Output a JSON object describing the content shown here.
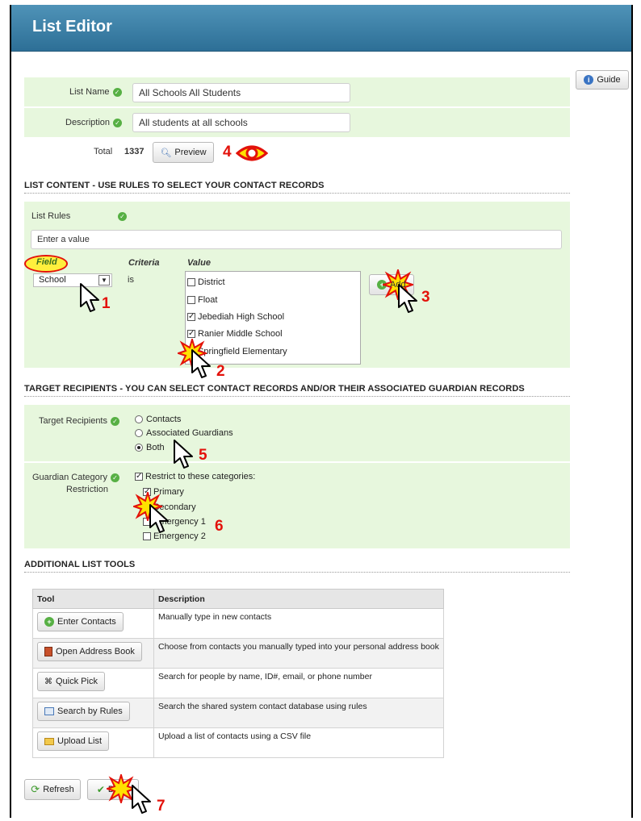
{
  "window": {
    "title": "List Editor"
  },
  "guide_button": {
    "label": "Guide",
    "icon": "info-icon"
  },
  "list_name": {
    "label": "List Name",
    "value": "All Schools All Students"
  },
  "description": {
    "label": "Description",
    "value": "All students at all schools"
  },
  "total": {
    "label": "Total",
    "value": "1337",
    "preview_label": "Preview"
  },
  "sections": {
    "list_content": "LIST CONTENT - USE RULES TO SELECT YOUR CONTACT RECORDS",
    "target_recipients": "TARGET RECIPIENTS - YOU CAN SELECT CONTACT RECORDS AND/OR THEIR ASSOCIATED GUARDIAN RECORDS",
    "additional_tools": "ADDITIONAL LIST TOOLS"
  },
  "list_rules": {
    "label": "List Rules",
    "input_value": "Enter a value",
    "field_header": "Field",
    "criteria_header": "Criteria",
    "value_header": "Value",
    "field_selected": "School",
    "criteria_value": "is",
    "values": [
      {
        "label": "District",
        "checked": false
      },
      {
        "label": "Float",
        "checked": false
      },
      {
        "label": "Jebediah High School",
        "checked": true
      },
      {
        "label": "Ranier Middle School",
        "checked": true
      },
      {
        "label": "Springfield Elementary",
        "checked": true
      }
    ],
    "add_label": "Add"
  },
  "target": {
    "label": "Target Recipients",
    "options": [
      {
        "label": "Contacts",
        "selected": false
      },
      {
        "label": "Associated Guardians",
        "selected": false
      },
      {
        "label": "Both",
        "selected": true
      }
    ]
  },
  "guardian": {
    "label_line1": "Guardian Category",
    "label_line2": "Restriction",
    "restrict_label": "Restrict to these categories:",
    "restrict_checked": true,
    "categories": [
      {
        "label": "Primary",
        "checked": true
      },
      {
        "label": "Secondary",
        "checked": true
      },
      {
        "label": "Emergency 1",
        "checked": false
      },
      {
        "label": "Emergency 2",
        "checked": false
      }
    ]
  },
  "tools_table": {
    "col_tool": "Tool",
    "col_description": "Description",
    "rows": [
      {
        "button": "Enter Contacts",
        "icon": "plus-icon",
        "description": "Manually type in new contacts"
      },
      {
        "button": "Open Address Book",
        "icon": "address-book-icon",
        "description": "Choose from contacts you manually typed into your personal address book"
      },
      {
        "button": "Quick Pick",
        "icon": "binoculars-icon",
        "description": "Search for people by name, ID#, email, or phone number"
      },
      {
        "button": "Search by Rules",
        "icon": "search-rules-icon",
        "description": "Search the shared system contact database using rules"
      },
      {
        "button": "Upload List",
        "icon": "folder-icon",
        "description": "Upload a list of contacts using a CSV file"
      }
    ]
  },
  "footer": {
    "refresh_label": "Refresh",
    "done_label": "Done"
  },
  "steps": [
    "1",
    "2",
    "3",
    "4",
    "5",
    "6",
    "7"
  ],
  "colors": {
    "accent": "#2d6f96",
    "panel": "#e7f7dd",
    "step": "#e3120b"
  }
}
